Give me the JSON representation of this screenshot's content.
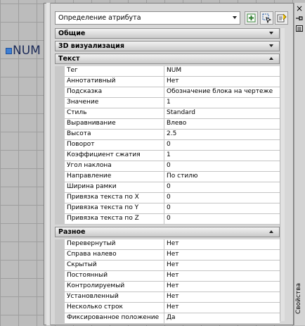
{
  "entity": {
    "text": "NUM"
  },
  "toolbar": {
    "object_select": "Определение атрибута"
  },
  "categories": [
    {
      "label": "Общие",
      "expanded": false
    },
    {
      "label": "3D визуализация",
      "expanded": false
    },
    {
      "label": "Текст",
      "expanded": true
    },
    {
      "label": "Разное",
      "expanded": true
    }
  ],
  "text_rows": [
    {
      "key": "Тег",
      "value": "NUM"
    },
    {
      "key": "Аннотативный",
      "value": "Нет"
    },
    {
      "key": "Подсказка",
      "value": "Обозначение блока на чертеже"
    },
    {
      "key": "Значение",
      "value": "1"
    },
    {
      "key": "Стиль",
      "value": "Standard"
    },
    {
      "key": "Выравнивание",
      "value": "Влево"
    },
    {
      "key": "Высота",
      "value": "2.5"
    },
    {
      "key": "Поворот",
      "value": "0"
    },
    {
      "key": "Коэффициент сжатия",
      "value": "1"
    },
    {
      "key": "Угол наклона",
      "value": "0"
    },
    {
      "key": "Направление",
      "value": "По стилю"
    },
    {
      "key": "Ширина рамки",
      "value": "0"
    },
    {
      "key": "Привязка текста по X",
      "value": "0"
    },
    {
      "key": "Привязка текста по Y",
      "value": "0"
    },
    {
      "key": "Привязка текста по Z",
      "value": "0"
    }
  ],
  "misc_rows": [
    {
      "key": "Перевернутый",
      "value": "Нет"
    },
    {
      "key": "Справа налево",
      "value": "Нет"
    },
    {
      "key": "Скрытый",
      "value": "Нет"
    },
    {
      "key": "Постоянный",
      "value": "Нет"
    },
    {
      "key": "Контролируемый",
      "value": "Нет"
    },
    {
      "key": "Установленный",
      "value": "Нет"
    },
    {
      "key": "Несколько строк",
      "value": "Нет"
    },
    {
      "key": "Фиксированное положение",
      "value": "Да"
    }
  ],
  "palette": {
    "tab_label": "Свойства"
  },
  "icons": {
    "close": "close-icon",
    "pin": "autohide-icon",
    "menu": "properties-menu-icon",
    "toggle_pickadd": "toggle-pickadd-icon",
    "select_objects": "select-objects-icon",
    "quick_select": "quick-select-icon"
  }
}
